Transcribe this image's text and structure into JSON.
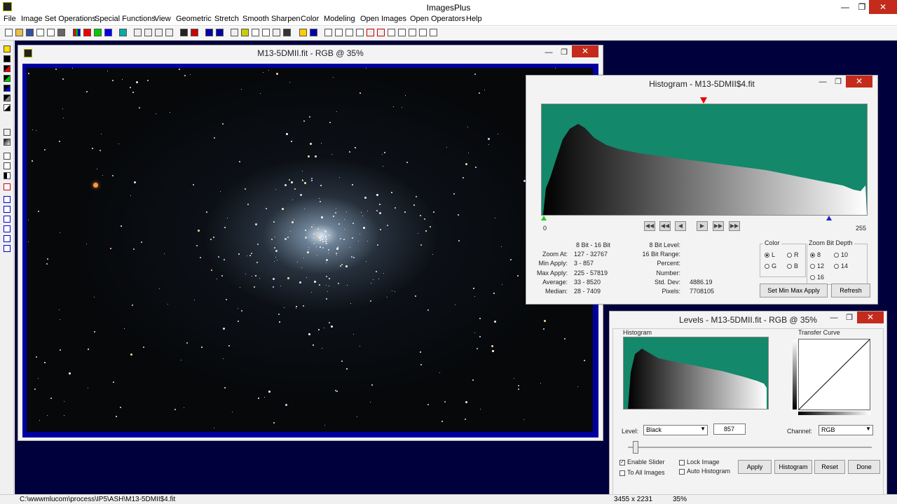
{
  "app": {
    "title": "ImagesPlus"
  },
  "window_controls": {
    "minimize": "—",
    "maximize": "❐",
    "close": "✕"
  },
  "menu": [
    "File",
    "Image Set Operations",
    "Special Functions",
    "View",
    "Geometric",
    "Stretch",
    "Smooth Sharpen",
    "Color",
    "Modeling",
    "Open Images",
    "Open Operators",
    "Help"
  ],
  "image_window": {
    "title": "M13-5DMII.fit - RGB @ 35%"
  },
  "histogram_window": {
    "title": "Histogram - M13-5DMII$4.fit",
    "axis_min": "0",
    "axis_max": "255",
    "stats": {
      "bit_range": "8 Bit - 16 Bit",
      "zoom_at_label": "Zoom At:",
      "zoom_at": "127 - 32767",
      "min_apply_label": "Min Apply:",
      "min_apply": "3 - 857",
      "max_apply_label": "Max Apply:",
      "max_apply": "225 - 57819",
      "average_label": "Average:",
      "average": "33 - 8520",
      "median_label": "Median:",
      "median": "28 - 7409",
      "bit8_level_label": "8 Bit Level:",
      "bit16_range_label": "16 Bit Range:",
      "percent_label": "Percent:",
      "number_label": "Number:",
      "std_dev_label": "Std. Dev:",
      "std_dev": "4886.19",
      "pixels_label": "Pixels:",
      "pixels": "7708105"
    },
    "color_group": {
      "title": "Color",
      "options": [
        "L",
        "R",
        "G",
        "B"
      ],
      "selected": "L"
    },
    "zoom_group": {
      "title": "Zoom Bit Depth",
      "options": [
        "8",
        "10",
        "12",
        "14",
        "16"
      ],
      "selected": "8"
    },
    "set_min_max_button": "Set Min Max Apply",
    "refresh_button": "Refresh"
  },
  "levels_window": {
    "title": "Levels - M13-5DMII.fit - RGB @ 35%",
    "histogram_label": "Histogram",
    "transfer_label": "Transfer Curve",
    "level_label": "Level:",
    "level_value": "Black",
    "level_number": "857",
    "channel_label": "Channel:",
    "channel_value": "RGB",
    "enable_slider": "Enable Slider",
    "enable_slider_checked": true,
    "to_all_images": "To All Images",
    "lock_image": "Lock Image",
    "auto_histogram": "Auto Histogram",
    "apply": "Apply",
    "histogram": "Histogram",
    "reset": "Reset",
    "done": "Done",
    "slider_level": 0.02
  },
  "status": {
    "path": "C:\\wwwmlucom\\process\\IP5\\ASH\\M13-5DMII$4.fit",
    "dims": "3455 x 2231",
    "zoom": "35%"
  },
  "colors": {
    "workspace": "#00003d",
    "histogram_bg": "#13886a",
    "image_border": "#0000a0",
    "close_button": "#c42b1c"
  }
}
